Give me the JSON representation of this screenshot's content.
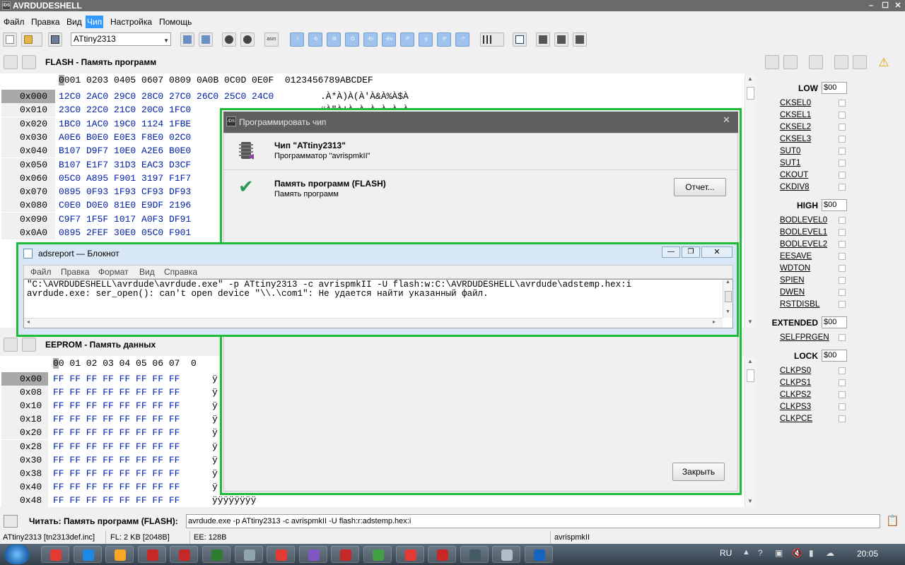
{
  "window": {
    "title": "AVRDUDESHELL",
    "icon_text": "/DS"
  },
  "menu": [
    "Файл",
    "Правка",
    "Вид",
    "Чип",
    "Настройка",
    "Помощь"
  ],
  "toolbar": {
    "chip": "ATtiny2313",
    "op_buttons": [
      "-l",
      "-b",
      "-B",
      "-D",
      "-Er",
      "-Ev",
      "-F",
      "-y",
      "-P",
      "-?"
    ],
    "asm_label": "asm"
  },
  "flash": {
    "title": "FLASH - Память программ",
    "header": "0001 0203 0405 0607 0809 0A0B 0C0D 0E0F  0123456789ABCDEF",
    "header_cursor": "0",
    "header_rest": "001 0203 0405 0607 0809 0A0B 0C0D 0E0F  0123456789ABCDEF",
    "rows": [
      {
        "addr": "0x000",
        "hex": "12C0 2AC0 29C0 28C0 27C0 26C0 25C0 24C0",
        "ascii": ".À*À)À(À'À&À%À$À"
      },
      {
        "addr": "0x010",
        "hex": "23C0 22C0 21C0 20C0 1FC0",
        "ascii": "#À\"À!À À.À.À.À.À"
      },
      {
        "addr": "0x020",
        "hex": "1BC0 1AC0 19C0 1124 1FBE",
        "ascii": ""
      },
      {
        "addr": "0x030",
        "hex": "A0E6 B0E0 E0E3 F8E0 02C0",
        "ascii": ""
      },
      {
        "addr": "0x040",
        "hex": "B107 D9F7 10E0 A2E6 B0E0",
        "ascii": ""
      },
      {
        "addr": "0x050",
        "hex": "B107 E1F7 31D3 EAC3 D3CF",
        "ascii": ""
      },
      {
        "addr": "0x060",
        "hex": "05C0 A895 F901 3197 F1F7",
        "ascii": ""
      },
      {
        "addr": "0x070",
        "hex": "0895 0F93 1F93 CF93 DF93",
        "ascii": ""
      },
      {
        "addr": "0x080",
        "hex": "C0E0 D0E0 81E0 E9DF 2196",
        "ascii": ""
      },
      {
        "addr": "0x090",
        "hex": "C9F7 1F5F 1017 A0F3 DF91",
        "ascii": ""
      },
      {
        "addr": "0x0A0",
        "hex": "0895 2FEF 30E0 05C0 F901",
        "ascii": ""
      }
    ]
  },
  "eeprom": {
    "title": "EEPROM - Память данных",
    "header_cursor": "0",
    "header_rest": "0 01 02 03 04 05 06 07  0",
    "rows": [
      {
        "addr": "0x00",
        "hex": "FF FF FF FF FF FF FF FF",
        "ascii": "ÿ"
      },
      {
        "addr": "0x08",
        "hex": "FF FF FF FF FF FF FF FF",
        "ascii": "ÿ"
      },
      {
        "addr": "0x10",
        "hex": "FF FF FF FF FF FF FF FF",
        "ascii": "ÿ"
      },
      {
        "addr": "0x18",
        "hex": "FF FF FF FF FF FF FF FF",
        "ascii": "ÿ"
      },
      {
        "addr": "0x20",
        "hex": "FF FF FF FF FF FF FF FF",
        "ascii": "ÿ"
      },
      {
        "addr": "0x28",
        "hex": "FF FF FF FF FF FF FF FF",
        "ascii": "ÿ"
      },
      {
        "addr": "0x30",
        "hex": "FF FF FF FF FF FF FF FF",
        "ascii": "ÿ"
      },
      {
        "addr": "0x38",
        "hex": "FF FF FF FF FF FF FF FF",
        "ascii": "ÿ"
      },
      {
        "addr": "0x40",
        "hex": "FF FF FF FF FF FF FF FF",
        "ascii": "ÿ"
      },
      {
        "addr": "0x48",
        "hex": "FF FF FF FF FF FF FF FF",
        "ascii": "ÿÿÿÿÿÿÿÿ"
      }
    ]
  },
  "fuses": {
    "low": {
      "title": "LOW",
      "value": "$00",
      "bits": [
        "CKSEL0",
        "CKSEL1",
        "CKSEL2",
        "CKSEL3",
        "SUT0",
        "SUT1",
        "CKOUT",
        "CKDIV8"
      ]
    },
    "high": {
      "title": "HIGH",
      "value": "$00",
      "bits": [
        "BODLEVEL0",
        "BODLEVEL1",
        "BODLEVEL2",
        "EESAVE",
        "WDTON",
        "SPIEN",
        "DWEN",
        "RSTDISBL"
      ]
    },
    "extended": {
      "title": "EXTENDED",
      "value": "$00",
      "bits": [
        "SELFPRGEN"
      ]
    },
    "lock": {
      "title": "LOCK",
      "value": "$00",
      "bits": [
        "CLKPS0",
        "CLKPS1",
        "CLKPS2",
        "CLKPS3",
        "CLKPCE"
      ]
    }
  },
  "prog_dialog": {
    "title": "Программировать чип",
    "chip_line": "Чип \"ATtiny2313\"",
    "programmer_line": "Программатор \"avrispmkII\"",
    "mem_title": "Память программ (FLASH)",
    "mem_sub": "Память программ",
    "report_button": "Отчет...",
    "close_button": "Закрыть"
  },
  "notepad": {
    "title": "adsreport — Блокнот",
    "menu": [
      "Файл",
      "Правка",
      "Формат",
      "Вид",
      "Справка"
    ],
    "lines": [
      "\"C:\\AVRDUDESHELL\\avrdude\\avrdude.exe\" -p ATtiny2313 -c avrispmkII -U flash:w:C:\\AVRDUDESHELL\\avrdude\\adstemp.hex:i",
      "avrdude.exe: ser_open(): can't open device \"\\\\.\\com1\": Не удается найти указанный файл."
    ]
  },
  "readbar": {
    "label": "Читать: Память программ (FLASH):",
    "command": "avrdude.exe -p ATtiny2313 -c avrispmkII -U flash:r:adstemp.hex:i"
  },
  "statusbar": {
    "device": "ATtiny2313 [tn2313def.inc]",
    "flash": "FL: 2 KB [2048B]",
    "eeprom": "EE: 128B",
    "programmer": "avrispmkII"
  },
  "taskbar": {
    "lang": "RU",
    "time": "20:05",
    "colors": [
      "#e53935",
      "#1e88e5",
      "#f9a825",
      "#c62828",
      "#c62828",
      "#2e7d32",
      "#90a4ae",
      "#e53935",
      "#7e57c2",
      "#c62828",
      "#43a047",
      "#e53935",
      "#c62828",
      "#455a64",
      "#b0bec5",
      "#1565c0"
    ]
  }
}
